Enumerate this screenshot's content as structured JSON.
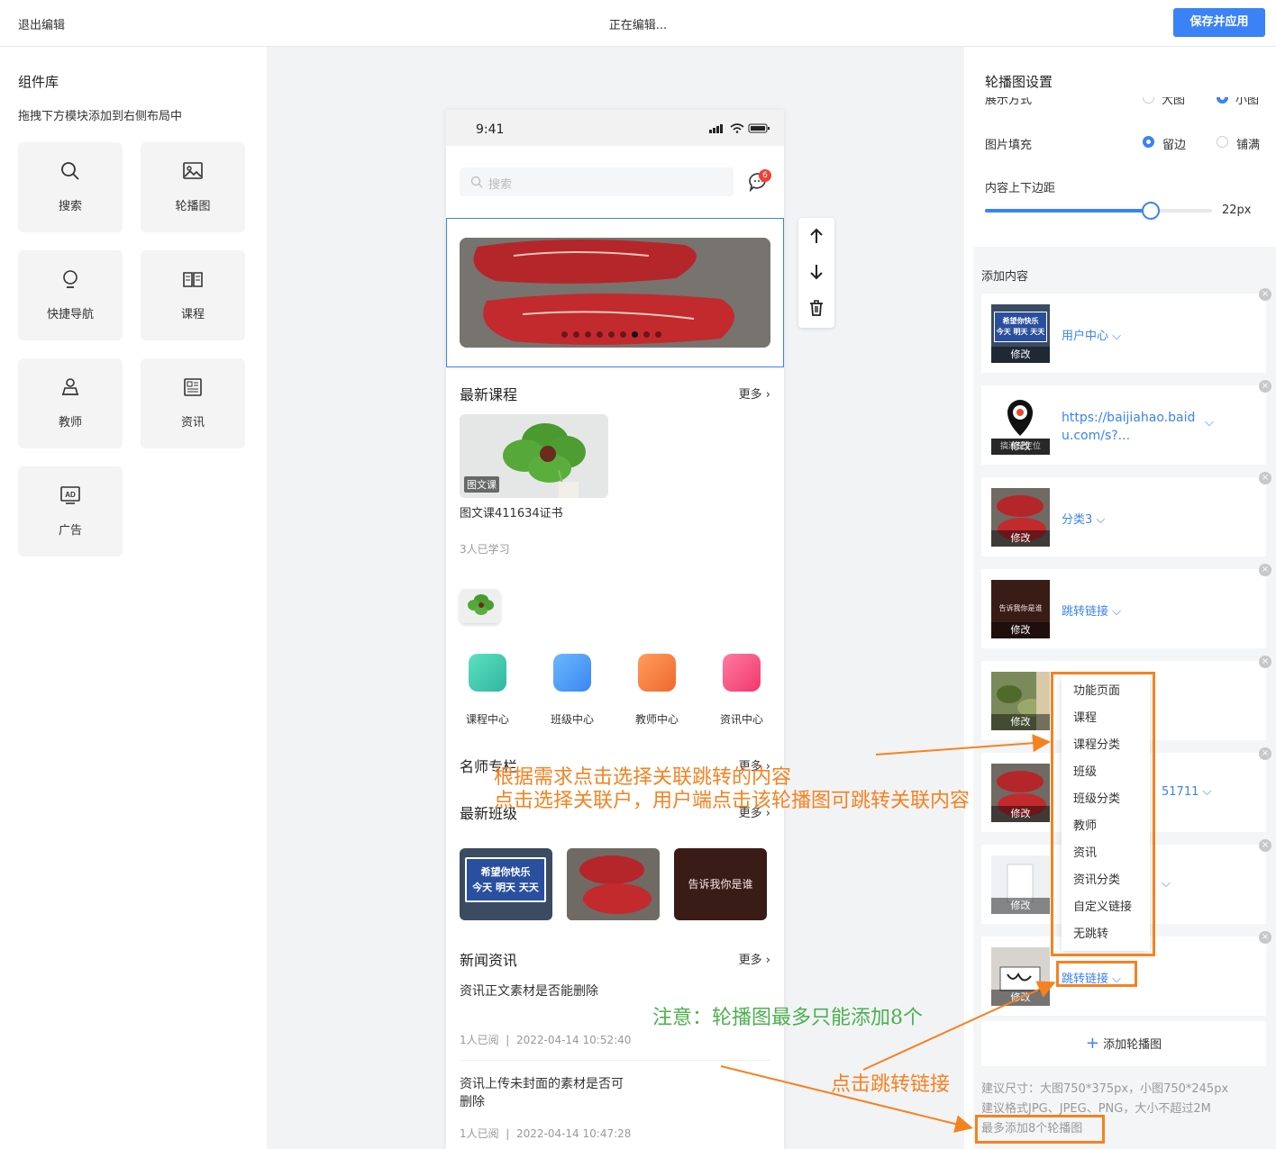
{
  "topbar": {
    "exit": "退出编辑",
    "status": "正在编辑...",
    "save": "保存并应用"
  },
  "library": {
    "title": "组件库",
    "subtitle": "拖拽下方模块添加到右侧布局中",
    "items": [
      {
        "label": "搜索",
        "icon": "search-icon"
      },
      {
        "label": "轮播图",
        "icon": "image-icon"
      },
      {
        "label": "快捷导航",
        "icon": "bulb-icon"
      },
      {
        "label": "课程",
        "icon": "book-icon"
      },
      {
        "label": "教师",
        "icon": "teacher-icon"
      },
      {
        "label": "资讯",
        "icon": "news-icon"
      },
      {
        "label": "广告",
        "icon": "ad-icon"
      }
    ]
  },
  "phone": {
    "time": "9:41",
    "search_placeholder": "搜索",
    "msg_count": "6",
    "latest_courses": "最新课程",
    "more": "更多",
    "course_tag": "图文课",
    "course_name": "图文课411634证书",
    "course_learners": "3人已学习",
    "quick_nav": [
      "课程中心",
      "班级中心",
      "教师中心",
      "资讯中心"
    ],
    "teachers_title": "名师专栏",
    "classes_title": "最新班级",
    "class_banner_text": "告诉我你是谁",
    "sign_line1": "希望你快乐",
    "sign_line2": "今天 明天 天天",
    "news_title": "新闻资讯",
    "news": [
      {
        "title": "资讯正文素材是否能删除",
        "views": "1人已阅",
        "time": "2022-04-14 10:52:40"
      },
      {
        "title_line1": "资讯上传未封面的素材是否可",
        "title_line2": "删除",
        "views": "1人已阅",
        "time": "2022-04-14 10:47:28"
      }
    ]
  },
  "settings": {
    "title": "轮播图设置",
    "display_label": "展示方式",
    "display_opt1": "大图",
    "display_opt2": "小图",
    "fill_label": "图片填充",
    "fill_opt1": "留边",
    "fill_opt2": "铺满",
    "padding_label": "内容上下边距",
    "padding_value": "22px",
    "padding_fraction": 0.73,
    "add_content": "添加内容",
    "edit": "修改",
    "items": [
      {
        "link": "用户中心"
      },
      {
        "link_line1": "https://baijiahao.baid",
        "link_line2": "u.com/s?..."
      },
      {
        "link": "分类3"
      },
      {
        "link": "跳转链接"
      },
      {
        "link": ""
      },
      {
        "link": "51711"
      },
      {
        "link": ""
      },
      {
        "link": "跳转链接"
      }
    ],
    "thumb_text_1_a": "希望你快乐",
    "thumb_text_1_b": "今天 明天 天天",
    "thumb_text_2": "搞清楚定位",
    "thumb_text_4": "告诉我你是谁",
    "add_banner": "添加轮播图",
    "tip1": "建议尺寸：大图750*375px，小图750*245px",
    "tip2": "建议格式JPG、JPEG、PNG，大小不超过2M",
    "tip3": "最多添加8个轮播图"
  },
  "dropdown": [
    "功能页面",
    "课程",
    "课程分类",
    "班级",
    "班级分类",
    "教师",
    "资讯",
    "资讯分类",
    "自定义链接",
    "无跳转"
  ],
  "annotations": {
    "a1": "根据需求点击选择关联跳转的内容",
    "a2": "点击选择关联户，用户端点击该轮播图可跳转关联内容",
    "a3": "注意：轮播图最多只能添加8个",
    "a4": "点击跳转链接"
  },
  "colors": {
    "accent": "#3b82f6",
    "annotation_orange": "#f58220",
    "annotation_green": "#4caf50"
  }
}
